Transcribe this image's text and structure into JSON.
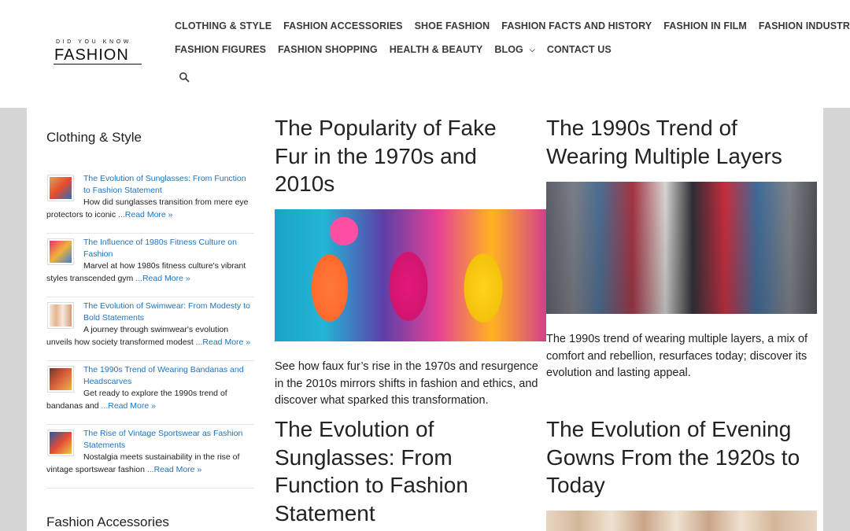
{
  "logo": {
    "small": "DID YOU KNOW",
    "big": "FASHION"
  },
  "nav": {
    "row1": [
      "CLOTHING & STYLE",
      "FASHION ACCESSORIES",
      "SHOE FASHION",
      "FASHION FACTS AND HISTORY",
      "FASHION IN FILM",
      "FASHION INDUSTRY"
    ],
    "row2": [
      "FASHION FIGURES",
      "FASHION SHOPPING",
      "HEALTH & BEAUTY",
      "BLOG",
      "CONTACT US"
    ],
    "search_icon": "search-icon"
  },
  "sidebar": {
    "widget1_title": "Clothing & Style",
    "items": [
      {
        "title": "The Evolution of Sunglasses: From Function to Fashion Statement",
        "excerpt": "How did sunglasses transition from mere eye protectors to iconic ",
        "more": "...Read More »"
      },
      {
        "title": "The Influence of 1980s Fitness Culture on Fashion",
        "excerpt": "Marvel at how 1980s fitness culture's vibrant styles transcended gym ",
        "more": "...Read More »"
      },
      {
        "title": "The Evolution of Swimwear: From Modesty to Bold Statements",
        "excerpt": "A journey through swimwear's evolution unveils how society transformed modest ",
        "more": "...Read More »"
      },
      {
        "title": "The 1990s Trend of Wearing Bandanas and Headscarves",
        "excerpt": "Get ready to explore the 1990s trend of bandanas and ",
        "more": "...Read More »"
      },
      {
        "title": "The Rise of Vintage Sportswear as Fashion Statements",
        "excerpt": "Nostalgia meets sustainability in the rise of vintage sportswear fashion ",
        "more": "...Read More »"
      }
    ],
    "widget2_title": "Fashion Accessories"
  },
  "posts": [
    {
      "title": "The Popularity of Fake Fur in the 1970s and 2010s",
      "excerpt": "See how faux fur’s rise in the 1970s and resurgence in the 2010s mirrors shifts in fashion and ethics, and discover what sparked this transformation."
    },
    {
      "title": "The 1990s Trend of Wearing Multiple Layers",
      "excerpt": "The 1990s trend of wearing multiple layers, a mix of comfort and rebellion, resurfaces today; discover its evolution and lasting appeal."
    },
    {
      "title": "The Evolution of Sunglasses: From Function to Fashion Statement"
    },
    {
      "title": "The Evolution of Evening Gowns From the 1920s to Today"
    }
  ]
}
